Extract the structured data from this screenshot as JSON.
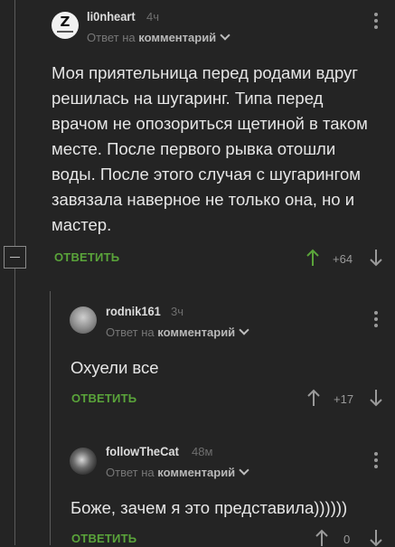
{
  "comments": [
    {
      "username": "li0nheart",
      "time": "4ч",
      "reply_prefix": "Ответ на",
      "reply_target": "комментарий",
      "text": "Моя приятельница перед родами вдруг решилась на шугаринг. Типа перед врачом не опозориться щетиной в таком месте. После первого рывка отошли воды. После этого случая с шугарингом завязала наверное не только она, но и мастер.",
      "answer_label": "ОТВЕТИТЬ",
      "score": "+64",
      "avatar_letter": "Z"
    },
    {
      "username": "rodnik161",
      "time": "3ч",
      "reply_prefix": "Ответ на",
      "reply_target": "комментарий",
      "text": "Охуели все",
      "answer_label": "ОТВЕТИТЬ",
      "score": "+17"
    },
    {
      "username": "followTheCat",
      "time": "48м",
      "reply_prefix": "Ответ на",
      "reply_target": "комментарий",
      "text": "Боже, зачем я это представила))))))",
      "answer_label": "ОТВЕТИТЬ",
      "score": "0"
    }
  ],
  "colors": {
    "background": "#242424",
    "answer": "#5aa43a",
    "thread_line": "#5a5a5a"
  },
  "icons": [
    "collapse-icon",
    "upvote-arrow-icon",
    "downvote-arrow-icon",
    "more-options-icon",
    "chevron-down-icon"
  ]
}
